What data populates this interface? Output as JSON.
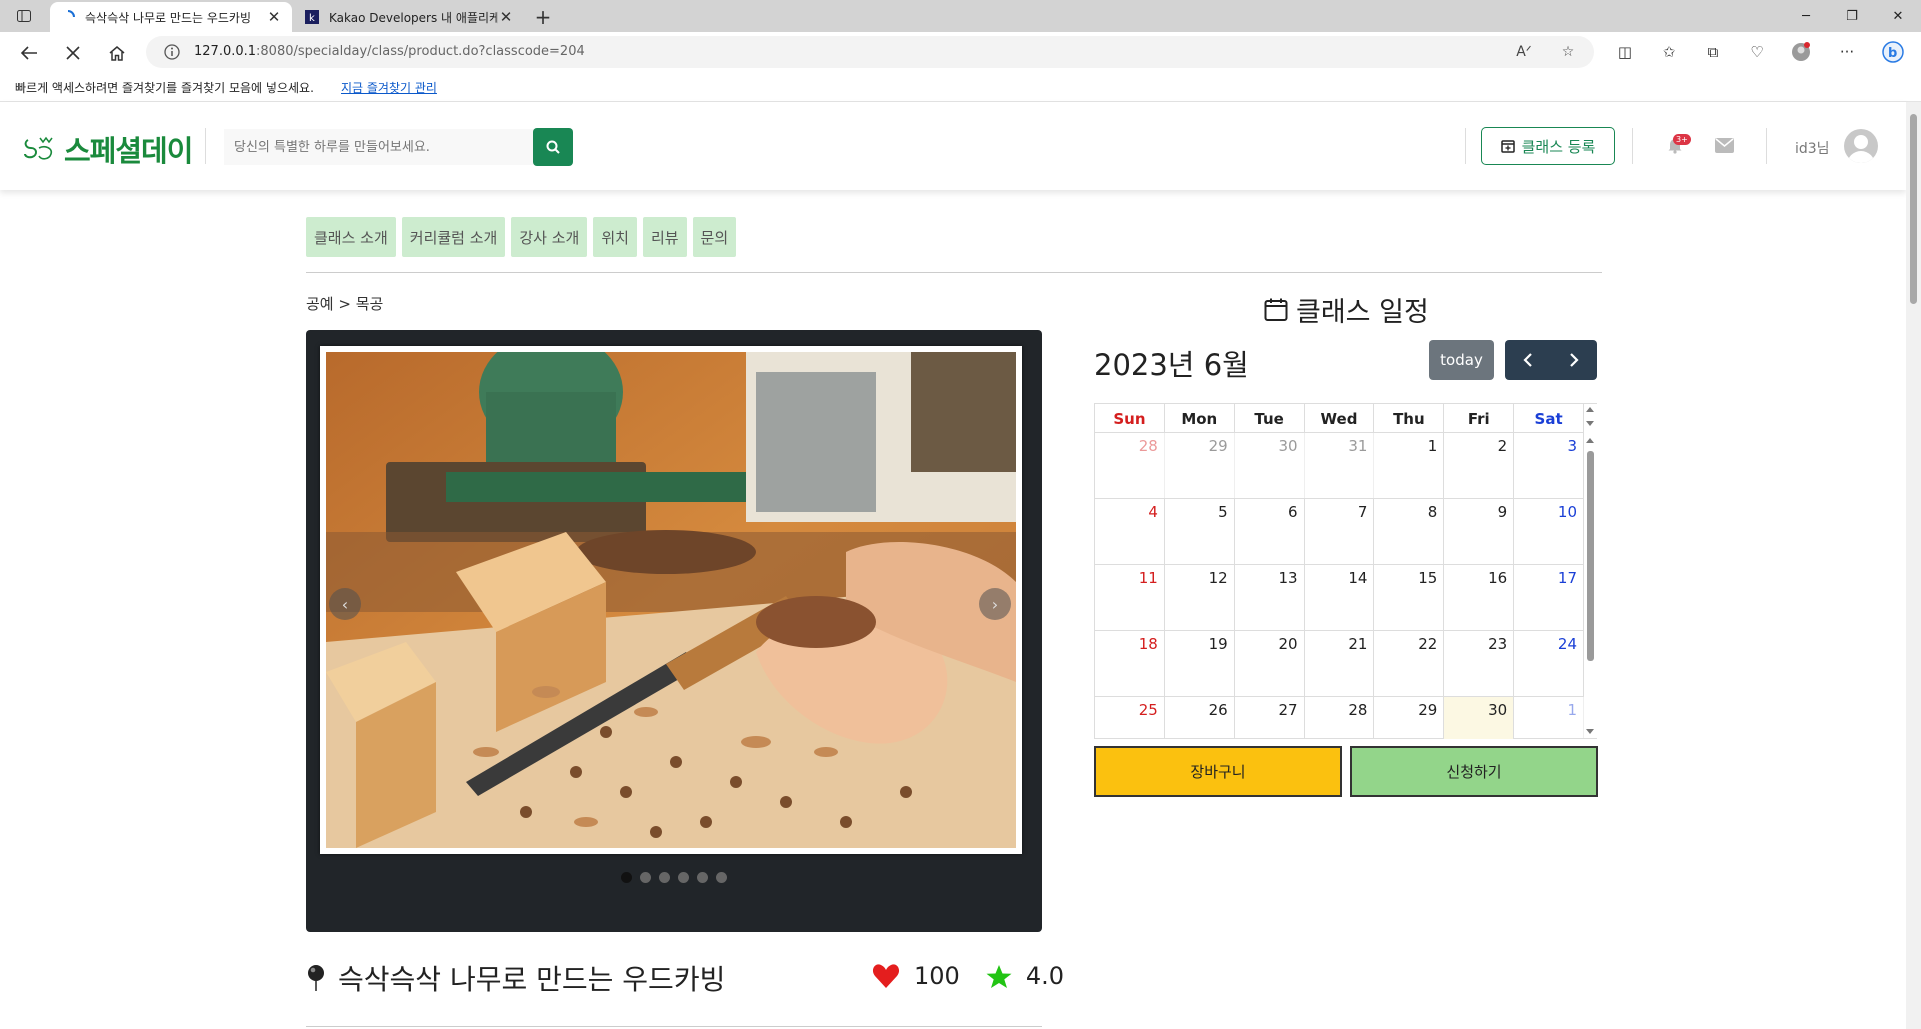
{
  "browser": {
    "tabs": [
      {
        "title": "슥삭슥삭 나무로 만드는 우드카빙",
        "active": true
      },
      {
        "title": "Kakao Developers 내 애플리케이",
        "active": false
      }
    ],
    "url_host": "127.0.0.1",
    "url_rest": ":8080/specialday/class/product.do?classcode=204",
    "favbar_message": "빠르게 액세스하려면 즐겨찾기를 즐겨찾기 모음에 넣으세요.",
    "favbar_link": "지금 즐겨찾기 관리"
  },
  "header": {
    "logo_text": "스페셜데이",
    "search_placeholder": "당신의 특별한 하루를 만들어보세요.",
    "register_button": "클래스 등록",
    "notification_badge": "3+",
    "user_name": "id3님"
  },
  "section_nav": {
    "tabs": [
      "클래스 소개",
      "커리큘럼 소개",
      "강사 소개",
      "위치",
      "리뷰",
      "문의"
    ]
  },
  "breadcrumb": "공예 > 목공",
  "carousel": {
    "slide_count": 6,
    "active_slide": 1
  },
  "product": {
    "title": "슥삭슥삭 나무로 만드는 우드카빙",
    "likes": "100",
    "rating": "4.0"
  },
  "calendar": {
    "section_title": "클래스 일정",
    "month_label": "2023년 6월",
    "today_label": "today",
    "weekdays": [
      "Sun",
      "Mon",
      "Tue",
      "Wed",
      "Thu",
      "Fri",
      "Sat"
    ],
    "weeks": [
      [
        "28",
        "29",
        "30",
        "31",
        "1",
        "2",
        "3"
      ],
      [
        "4",
        "5",
        "6",
        "7",
        "8",
        "9",
        "10"
      ],
      [
        "11",
        "12",
        "13",
        "14",
        "15",
        "16",
        "17"
      ],
      [
        "18",
        "19",
        "20",
        "21",
        "22",
        "23",
        "24"
      ],
      [
        "25",
        "26",
        "27",
        "28",
        "29",
        "30",
        "1"
      ]
    ]
  },
  "actions": {
    "cart_button": "장바구니",
    "apply_button": "신청하기"
  },
  "colors": {
    "brand_green": "#198754",
    "tab_bg": "#cdeccf",
    "cart_yellow": "#fbc10f",
    "apply_green": "#93d58a",
    "sunday_red": "#d41e1e",
    "saturday_blue": "#1a3fd6"
  }
}
